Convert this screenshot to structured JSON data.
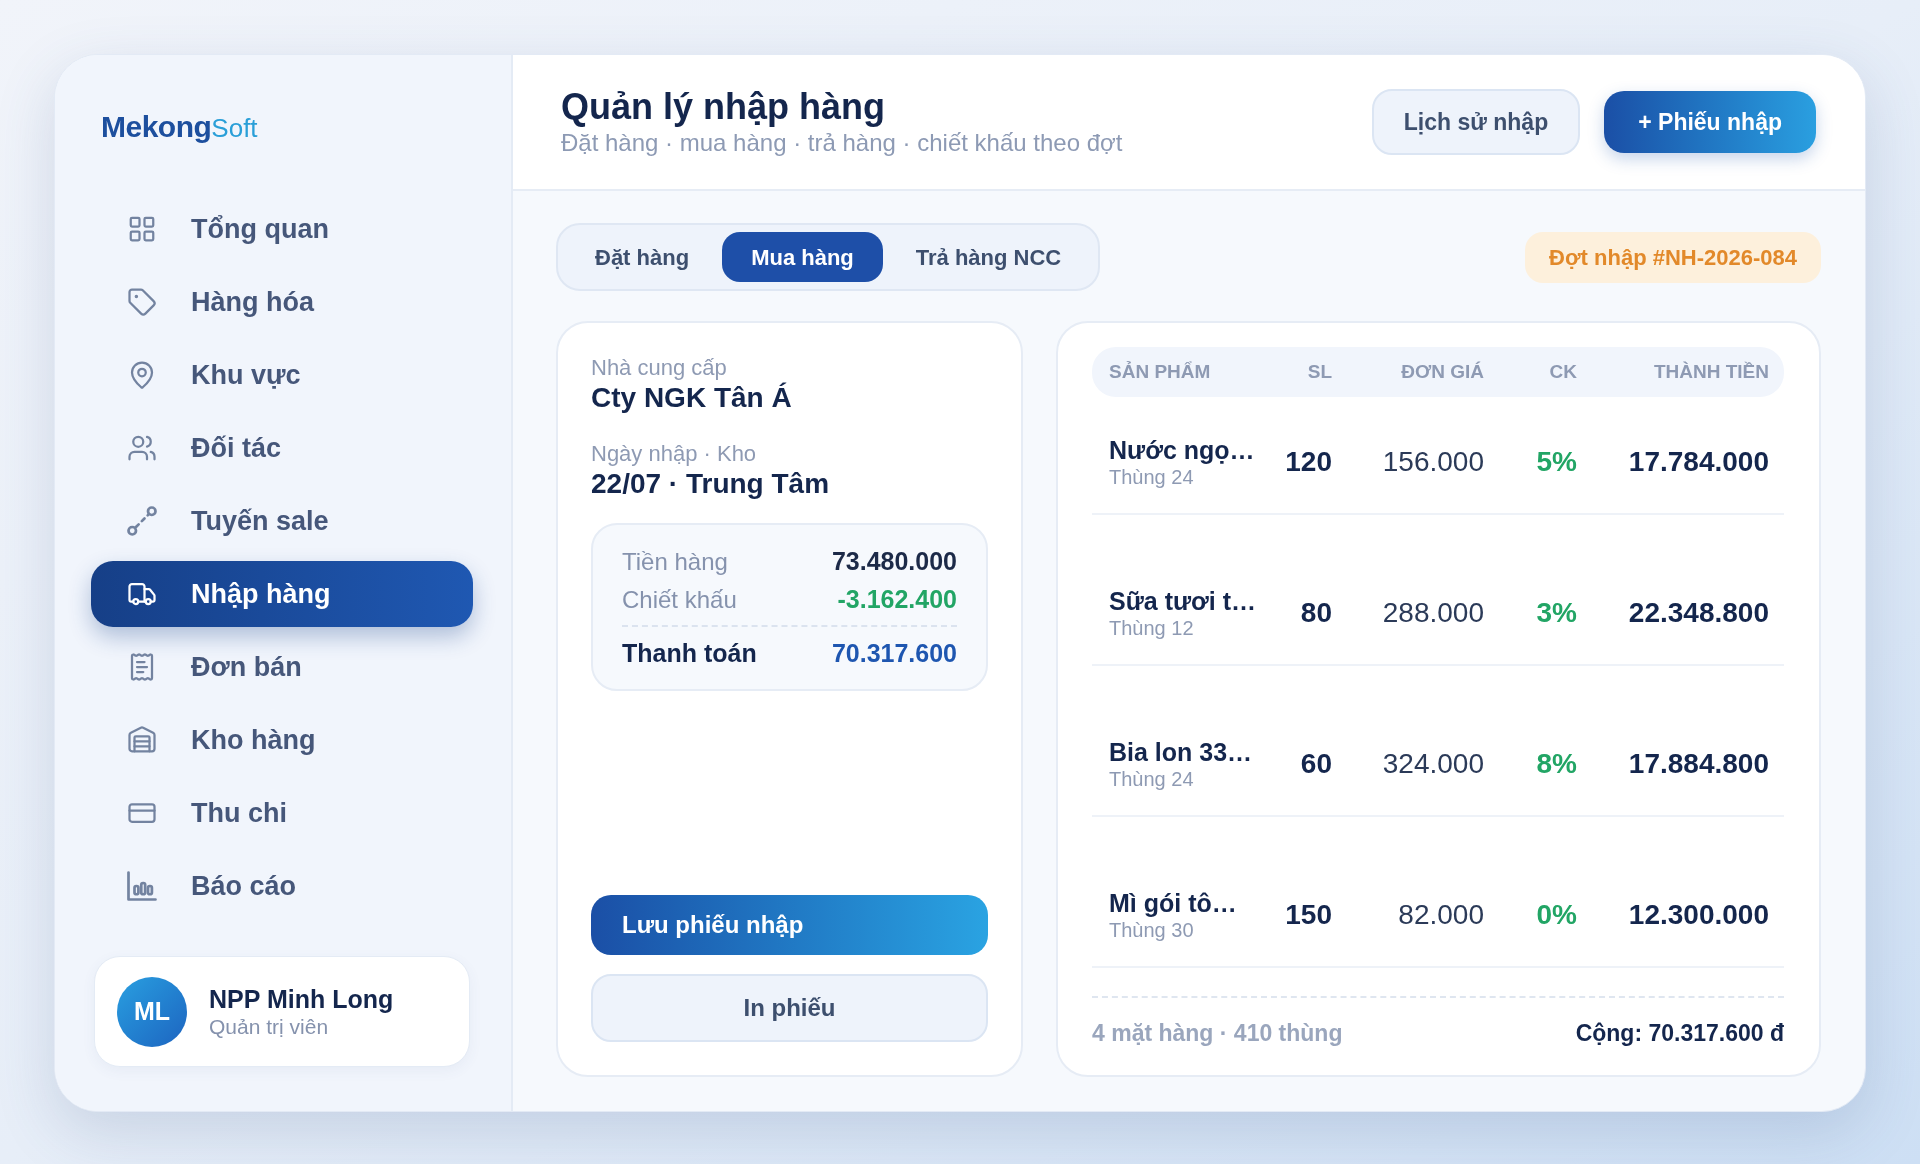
{
  "sidebar": {
    "logo": {
      "primary": "Mekong",
      "secondary": "Soft"
    },
    "items": [
      {
        "label": "Tổng quan",
        "selected": false
      },
      {
        "label": "Hàng hóa",
        "selected": false
      },
      {
        "label": "Khu vực",
        "selected": false
      },
      {
        "label": "Đối tác",
        "selected": false
      },
      {
        "label": "Tuyến sale",
        "selected": false
      },
      {
        "label": "Nhập hàng",
        "selected": true
      },
      {
        "label": "Đơn bán",
        "selected": false
      },
      {
        "label": "Kho hàng",
        "selected": false
      },
      {
        "label": "Thu chi",
        "selected": false
      },
      {
        "label": "Báo cáo",
        "selected": false
      }
    ],
    "user": {
      "initials": "ML",
      "name": "NPP Minh Long",
      "role": "Quản trị viên"
    }
  },
  "header": {
    "title": "Quản lý nhập hàng",
    "subtitle": "Đặt hàng · mua hàng · trả hàng · chiết khấu theo đợt",
    "buttons": [
      {
        "label": "Lịch sử nhập",
        "kind": "secondary"
      },
      {
        "label": "+ Phiếu nhập",
        "kind": "primary"
      }
    ]
  },
  "tabs": [
    {
      "label": "Đặt hàng",
      "selected": false
    },
    {
      "label": "Mua hàng",
      "selected": true
    },
    {
      "label": "Trả hàng NCC",
      "selected": false
    }
  ],
  "batch_badge": "Đợt nhập #NH-2026-084",
  "order": {
    "supplier_label": "Nhà cung cấp",
    "supplier": "Cty NGK Tân Á",
    "date_label": "Ngày nhập · Kho",
    "date_value": "22/07 · Trung Tâm",
    "summary": [
      {
        "kind": "normal",
        "label": "Tiền hàng",
        "value": "73.480.000"
      },
      {
        "kind": "discount",
        "label": "Chiết khấu",
        "value": "-3.162.400"
      },
      {
        "kind": "total",
        "label": "Thanh toán",
        "value": "70.317.600"
      }
    ],
    "buttons": [
      {
        "label": "Lưu phiếu nhập",
        "kind": "primary"
      },
      {
        "label": "In phiếu",
        "kind": "secondary"
      }
    ]
  },
  "table": {
    "columns": [
      "SẢN PHẨM",
      "SL",
      "ĐƠN GIÁ",
      "CK",
      "THÀNH TIỀN"
    ],
    "rows": [
      {
        "name": "Nước ngọ…",
        "unit": "Thùng 24",
        "qty": "120",
        "price": "156.000",
        "discount": "5%",
        "total": "17.784.000"
      },
      {
        "name": "Sữa tươi t…",
        "unit": "Thùng 12",
        "qty": "80",
        "price": "288.000",
        "discount": "3%",
        "total": "22.348.800"
      },
      {
        "name": "Bia lon 33…",
        "unit": "Thùng 24",
        "qty": "60",
        "price": "324.000",
        "discount": "8%",
        "total": "17.884.800"
      },
      {
        "name": "Mì gói tô…",
        "unit": "Thùng 30",
        "qty": "150",
        "price": "82.000",
        "discount": "0%",
        "total": "12.300.000"
      }
    ],
    "footer": {
      "summary": "4 mặt hàng · 410 thùng",
      "total": "Cộng: 70.317.600 đ"
    }
  }
}
